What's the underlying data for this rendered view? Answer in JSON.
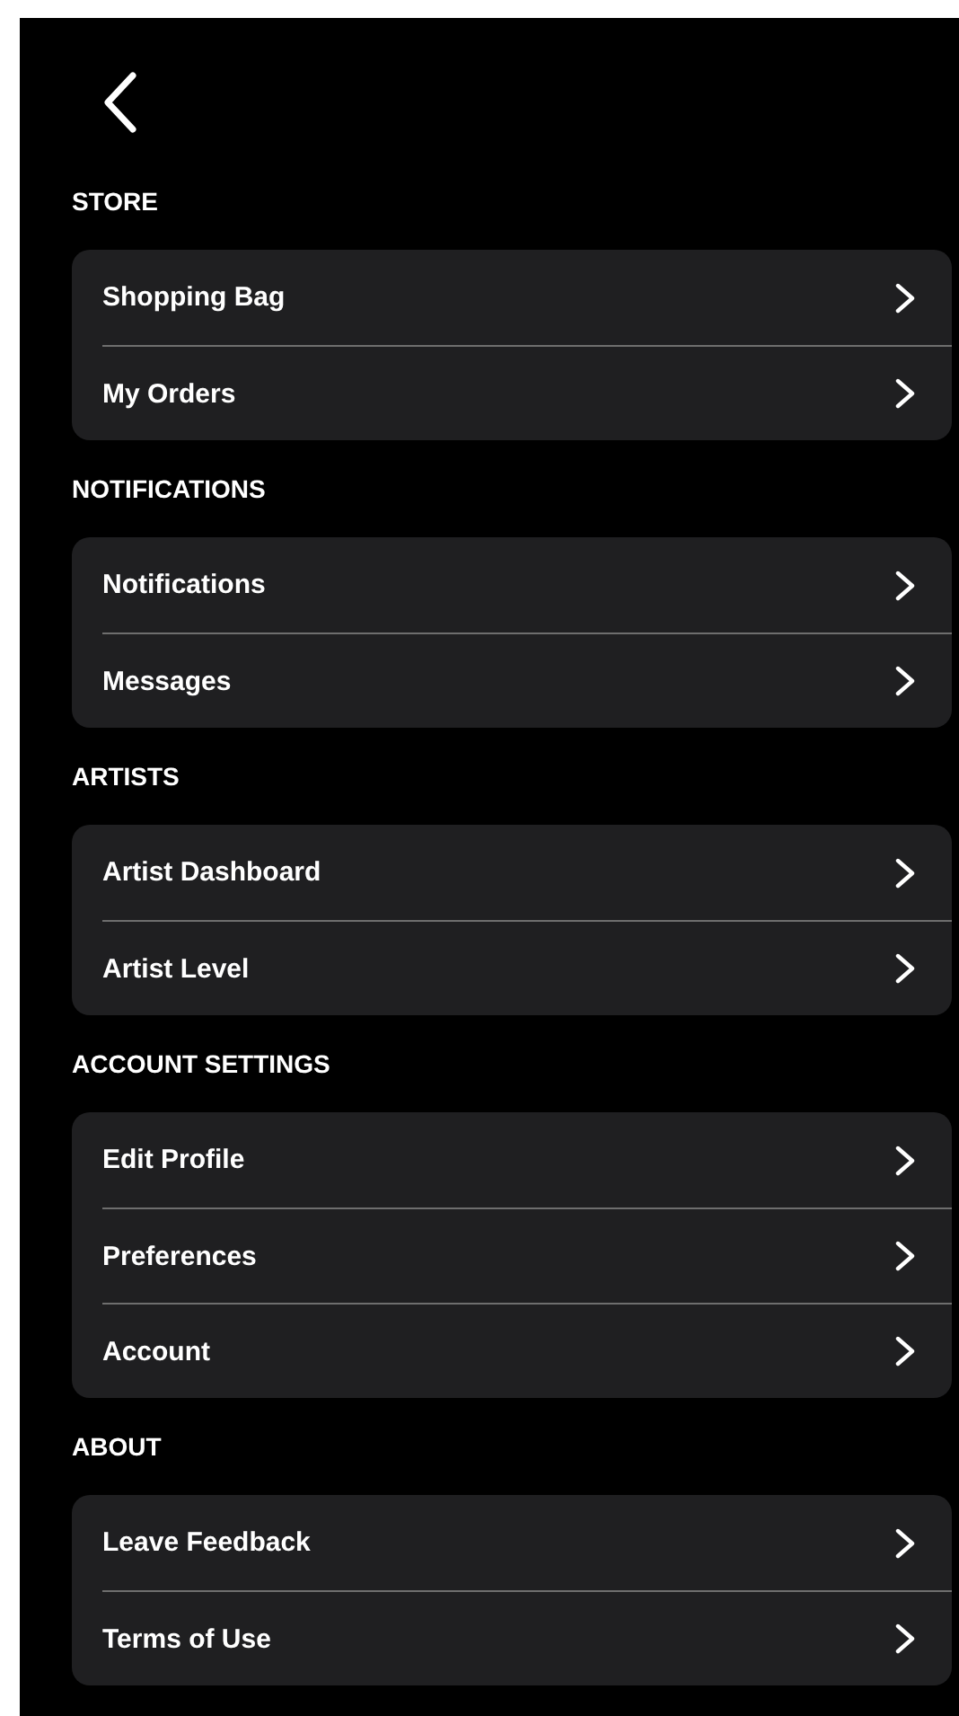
{
  "sections": [
    {
      "title": "STORE",
      "items": [
        {
          "label": "Shopping Bag"
        },
        {
          "label": "My Orders"
        }
      ]
    },
    {
      "title": "NOTIFICATIONS",
      "items": [
        {
          "label": "Notifications"
        },
        {
          "label": "Messages"
        }
      ]
    },
    {
      "title": "ARTISTS",
      "items": [
        {
          "label": "Artist Dashboard"
        },
        {
          "label": "Artist Level"
        }
      ]
    },
    {
      "title": "ACCOUNT SETTINGS",
      "items": [
        {
          "label": "Edit Profile"
        },
        {
          "label": "Preferences"
        },
        {
          "label": "Account"
        }
      ]
    },
    {
      "title": "ABOUT",
      "items": [
        {
          "label": "Leave Feedback"
        },
        {
          "label": "Terms of Use"
        }
      ]
    }
  ]
}
